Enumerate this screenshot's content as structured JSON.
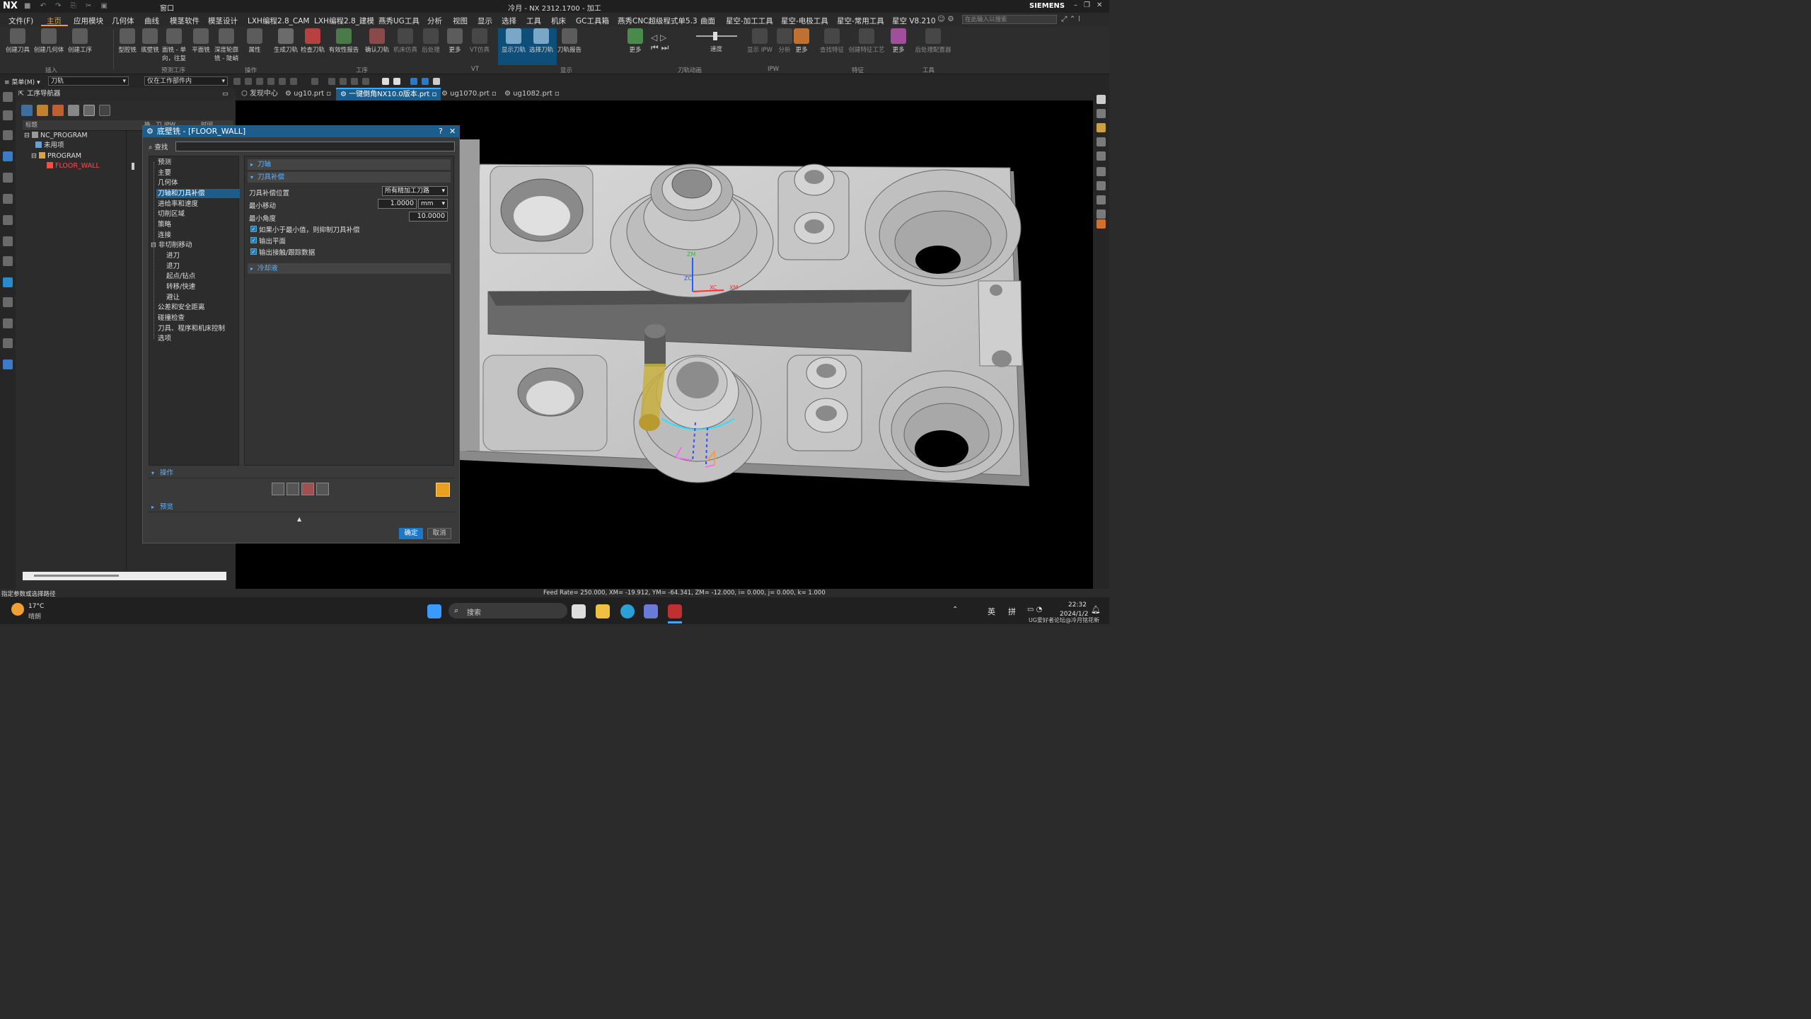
{
  "titlebar": {
    "app_logo": "NX",
    "window_title": "冷月 - NX 2312.1700 - 加工",
    "window_menu": "窗口",
    "brand": "SIEMENS"
  },
  "menu": {
    "file": "文件(F)",
    "items": [
      "主页",
      "应用模块",
      "几何体",
      "曲线",
      "模茎软件",
      "模茎设计",
      "LXH编程2.8_CAM",
      "LXH编程2.8_建模",
      "燕秀UG工具",
      "分析",
      "视图",
      "显示",
      "选择",
      "工具",
      "机床",
      "GC工具箱",
      "燕秀CNC超级程式单5.3",
      "曲面",
      "星空-加工工具",
      "星空-电极工具",
      "星空-常用工具",
      "星空 V8.210"
    ],
    "search_placeholder": "在此输入以搜索"
  },
  "ribbon": {
    "buttons": [
      "创建刀具",
      "创建几何体",
      "创建工序",
      "型腔铣",
      "底壁铣",
      "面铣 - 单向，往复",
      "平面铣",
      "深度轮廓铣 - 陡峭",
      "属性",
      "生成刀轨",
      "检查刀轨",
      "有效性报告",
      "确认刀轨",
      "机床仿真",
      "后处理",
      "更多",
      "VT仿真",
      "显示刀轨",
      "选择刀轨",
      "刀轨报告",
      "更多",
      "速度",
      "显示 IPW",
      "分析",
      "更多",
      "查找特征",
      "创建特征工艺",
      "更多",
      "后处理配置器"
    ],
    "groups": [
      "插入",
      "预测工序",
      "操作",
      "工序",
      "VT",
      "显示",
      "刀轨动画",
      "IPW",
      "特征",
      "工具"
    ]
  },
  "toolbar2": {
    "menu_label": "菜单(M)",
    "filter_value": "刀轨",
    "scope_value": "仅在工作部件内"
  },
  "navigator": {
    "title": "工序导航器",
    "columns": [
      "标题",
      "换",
      "刀",
      "IPW",
      "时间"
    ],
    "tree": [
      {
        "label": "NC_PROGRAM",
        "depth": 0
      },
      {
        "label": "未用项",
        "depth": 1
      },
      {
        "label": "PROGRAM",
        "depth": 1
      },
      {
        "label": "FLOOR_WALL",
        "depth": 2,
        "highlight": true
      }
    ]
  },
  "tabs": [
    "发现中心",
    "ug10.prt",
    "一键倒角NX10.0版本.prt",
    "ug1070.prt",
    "ug1082.prt"
  ],
  "dialog": {
    "title": "底壁铣 - [FLOOR_WALL]",
    "help": "?",
    "close": "✕",
    "find_label": "查找",
    "categories": [
      "预测",
      "主要",
      "几何体",
      "刀轴和刀具补偿",
      "进给率和速度",
      "切削区域",
      "策略",
      "连接",
      "非切削移动",
      "进刀",
      "退刀",
      "起点/钻点",
      "转移/快速",
      "避让",
      "公差和安全距离",
      "碰撞检查",
      "刀具、程序和机床控制",
      "选项"
    ],
    "selected_category": "刀轴和刀具补偿",
    "sections": {
      "tool_axis": "刀轴",
      "cutter_comp": "刀具补偿",
      "coolant": "冷却液"
    },
    "comp_position_label": "刀具补偿位置",
    "comp_position_value": "所有精加工刀路",
    "min_move_label": "最小移动",
    "min_move_value": "1.0000",
    "min_move_unit": "mm",
    "min_angle_label": "最小角度",
    "min_angle_value": "10.0000",
    "checks": [
      "如果小于最小值，则抑制刀具补偿",
      "输出平面",
      "输出接触/跟踪数据"
    ],
    "operations_label": "操作",
    "preview_label": "预览",
    "ok": "确定",
    "cancel": "取消"
  },
  "viewport_labels": {
    "xc": "XC",
    "xm": "XM",
    "zc": "ZC",
    "zm": "ZM"
  },
  "status": {
    "prompt": "指定参数或选择路径",
    "readout": "Feed Rate= 250.000, XM= -19.912, YM= -64.341, ZM= -12.000, i= 0.000, j= 0.000, k= 1.000"
  },
  "taskbar": {
    "weather_temp": "17°C",
    "weather_desc": "晴朗",
    "search": "搜索",
    "lang1": "英",
    "lang2": "拼",
    "time": "22:32",
    "date": "2024/1/2",
    "watermark": "UG爱好者论坛@冷月铭花新"
  },
  "colors": {
    "accent": "#1b5e8e",
    "highlight": "#f0a030",
    "link": "#5db2ff",
    "warning": "#e8a020"
  }
}
